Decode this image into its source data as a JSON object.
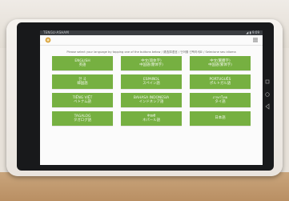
{
  "statusbar": {
    "left": "TENGU-ASHAM",
    "right": "◢ ▮ 9:09"
  },
  "instruction": "Please select your language by tapping one of the buttons below / 请选择语言 / 언어를 선택하세요 / Selecione seu idioma",
  "languages": [
    {
      "line1": "ENGLISH",
      "line2": "英語"
    },
    {
      "line1": "中文(简体字)",
      "line2": "中国語(簡体字)"
    },
    {
      "line1": "中文(繁體字)",
      "line2": "中国語(繁体字)"
    },
    {
      "line1": "한 국",
      "line2": "韓国語"
    },
    {
      "line1": "ESPAÑOL",
      "line2": "スペイン語"
    },
    {
      "line1": "PORTUGUÊS",
      "line2": "ポルトガル語"
    },
    {
      "line1": "TIẾNG VIỆT",
      "line2": "ベトナム語"
    },
    {
      "line1": "BAHASA INDONESIA",
      "line2": "インドネシア語"
    },
    {
      "line1": "ภาษาไทย",
      "line2": "タイ語"
    },
    {
      "line1": "TAGALOG",
      "line2": "タガログ語"
    },
    {
      "line1": "नेपाली",
      "line2": "ネパール語"
    },
    {
      "line1": "",
      "line2": "日本語"
    }
  ],
  "colors": {
    "button": "#76b041",
    "screen": "#fbfbfb",
    "bezel": "#18191b"
  }
}
